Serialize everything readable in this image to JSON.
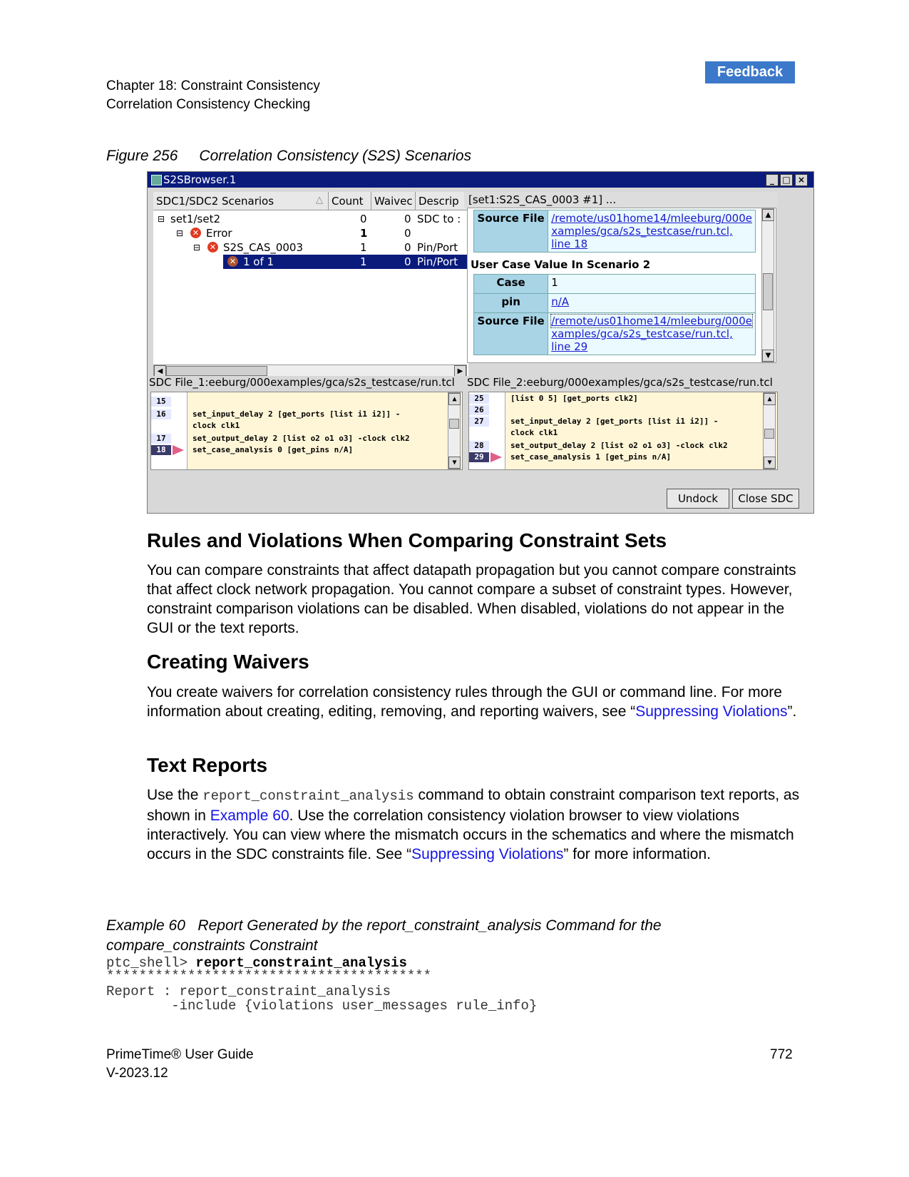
{
  "header": {
    "feedback": "Feedback",
    "chapter": "Chapter 18: Constraint Consistency",
    "section": "Correlation Consistency Checking"
  },
  "figure": {
    "number": "Figure 256",
    "title": "Correlation Consistency (S2S) Scenarios"
  },
  "window": {
    "title": "S2SBrowser.1",
    "tree_columns": [
      "SDC1/SDC2 Scenarios",
      "Count",
      "Waivec",
      "Descrip"
    ],
    "tree_rows": [
      {
        "label": "set1/set2",
        "count": "0",
        "waived": "0",
        "desc": "SDC to :"
      },
      {
        "label": "Error",
        "count": "1",
        "waived": "0",
        "desc": ""
      },
      {
        "label": "S2S_CAS_0003",
        "count": "1",
        "waived": "0",
        "desc": "Pin/Port"
      },
      {
        "label": "1 of 1",
        "count": "1",
        "waived": "0",
        "desc": "Pin/Port"
      }
    ],
    "detail_header": "[set1:S2S_CAS_0003 #1] ...",
    "source_file_label": "Source File",
    "source_file_1": [
      "/remote/us01home14/mleeburg/000e",
      "xamples/gca/s2s_testcase/run.tcl,",
      "line 18"
    ],
    "scenario2_title": "User Case Value In Scenario 2",
    "case_label": "Case",
    "case_value": "1",
    "pin_label": "pin",
    "pin_value": "n/A",
    "source_file_2": [
      "/remote/us01home14/mleeburg/000e",
      "xamples/gca/s2s_testcase/run.tcl,",
      "line 29"
    ],
    "sdc1_title": "SDC File_1:eeburg/000examples/gca/s2s_testcase/run.tcl",
    "sdc2_title": "SDC File_2:eeburg/000examples/gca/s2s_testcase/run.tcl",
    "sdc1_lines": [
      {
        "n": "15",
        "code": ""
      },
      {
        "n": "16",
        "code": "set_input_delay 2 [get_ports [list  i1 i2]] -"
      },
      {
        "n": "",
        "code": "clock clk1"
      },
      {
        "n": "17",
        "code": "set_output_delay 2 [list o2 o1 o3] -clock clk2"
      },
      {
        "n": "18",
        "code": "set_case_analysis 0 [get_pins n/A]"
      }
    ],
    "sdc2_lines": [
      {
        "n": "25",
        "code": "[list 0 5] [get_ports clk2]"
      },
      {
        "n": "26",
        "code": ""
      },
      {
        "n": "27",
        "code": "set_input_delay 2 [get_ports [list  i1 i2]] -"
      },
      {
        "n": "",
        "code": "clock clk1"
      },
      {
        "n": "28",
        "code": "set_output_delay 2 [list o2 o1 o3] -clock clk2"
      },
      {
        "n": "29",
        "code": "set_case_analysis 1 [get_pins n/A]"
      }
    ],
    "undock": "Undock",
    "close_sdc": "Close SDC"
  },
  "sections": {
    "rules_title": "Rules and Violations When Comparing Constraint Sets",
    "rules_text": "You can compare constraints that affect datapath propagation but you cannot compare constraints that affect clock network propagation. You cannot compare a subset of constraint types. However, constraint comparison violations can be disabled. When disabled, violations do not appear in the GUI or the text reports.",
    "waivers_title": "Creating Waivers",
    "waivers_text": "You create waivers for correlation consistency rules through the GUI or command line. For more information about creating, editing, removing, and reporting waivers, see",
    "waivers_link": "Suppressing Violations",
    "reports_title": "Text Reports",
    "reports_use": "Use the",
    "reports_cmd": "report_constraint_analysis",
    "reports_text1": "command to obtain constraint comparison text reports, as shown in",
    "reports_link1": "Example 60",
    "reports_text2": ". Use the correlation consistency violation browser to view violations interactively. You can view where the mismatch occurs in the schematics and where the mismatch occurs in the SDC constraints file. See",
    "reports_link2": "Suppressing Violations",
    "reports_text3": "for more information."
  },
  "example": {
    "caption_num": "Example 60",
    "caption_text": "Report Generated by the report_constraint_analysis Command for the compare_constraints Constraint",
    "prompt": "ptc_shell> ",
    "command": "report_constraint_analysis",
    "stars": "****************************************",
    "report_line1": "Report : report_constraint_analysis",
    "report_line2": "        -include {violations user_messages rule_info}"
  },
  "footer": {
    "guide": "PrimeTime® User Guide",
    "version": "V-2023.12",
    "page": "772"
  }
}
